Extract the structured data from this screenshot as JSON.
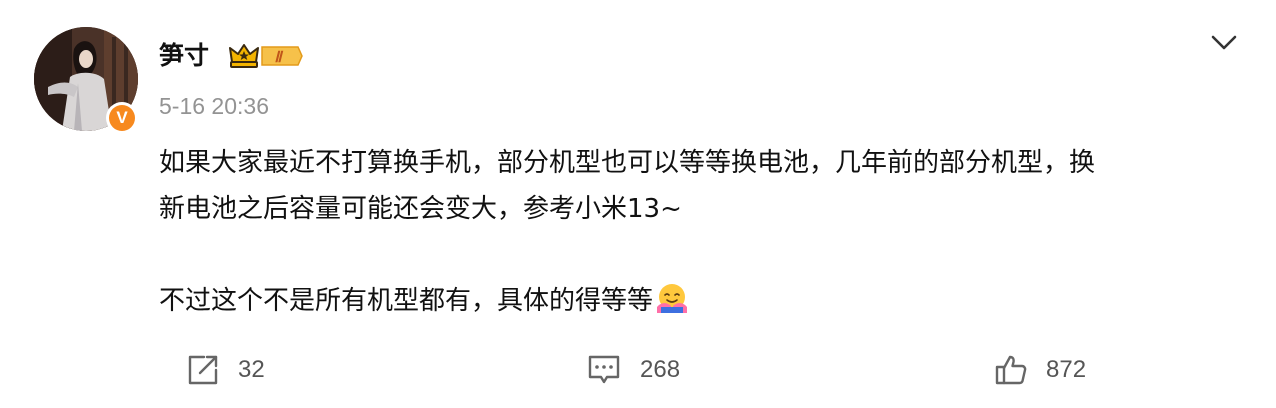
{
  "post": {
    "author": {
      "name": "笋寸",
      "badge_level": "Ⅱ",
      "verified_mark": "V"
    },
    "timestamp": "5-16 20:36",
    "content": {
      "paragraph_1_line_1": "如果大家最近不打算换手机，部分机型也可以等等换电池，几年前的部分机型，换",
      "paragraph_1_line_2": "新电池之后容量可能还会变大，参考小米13~",
      "paragraph_2": "不过这个不是所有机型都有，具体的得等等"
    },
    "actions": {
      "repost_count": "32",
      "comment_count": "268",
      "like_count": "872"
    },
    "icons": {
      "menu": "chevron-down-icon",
      "repost": "repost-icon",
      "comment": "comment-icon",
      "like": "thumbs-up-icon",
      "emoji": "hugging-face-emoji"
    },
    "colors": {
      "verified": "#f7891e",
      "badge_gold": "#f4b400",
      "timestamp": "#939393"
    }
  }
}
